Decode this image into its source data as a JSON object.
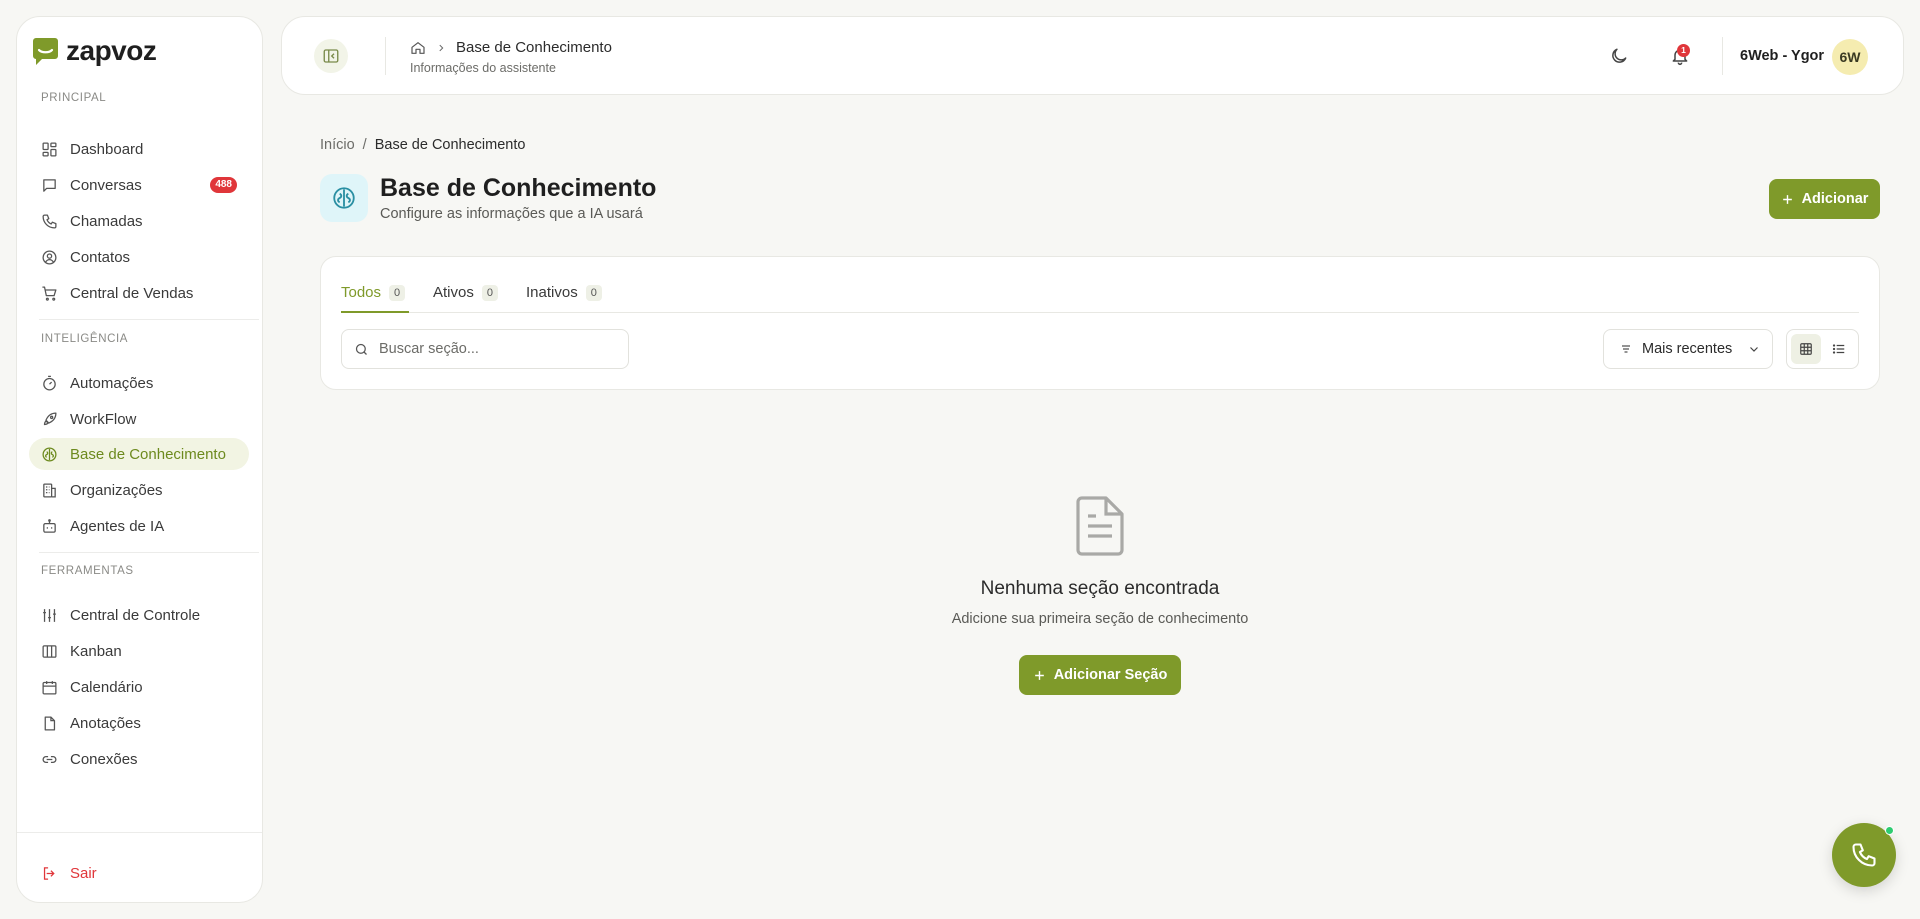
{
  "brand": {
    "name": "zapvoz",
    "accent": "#7f9a2a",
    "danger": "#e0363a"
  },
  "sidebar": {
    "sections": [
      {
        "title": "PRINCIPAL"
      },
      {
        "title": "INTELIGÊNCIA"
      },
      {
        "title": "FERRAMENTAS"
      }
    ],
    "items": [
      {
        "label": "Dashboard",
        "icon": "dashboard-icon"
      },
      {
        "label": "Conversas",
        "icon": "chat-icon",
        "badge": "488"
      },
      {
        "label": "Chamadas",
        "icon": "phone-icon"
      },
      {
        "label": "Contatos",
        "icon": "user-circle-icon"
      },
      {
        "label": "Central de Vendas",
        "icon": "cart-icon"
      },
      {
        "label": "Automações",
        "icon": "timer-icon"
      },
      {
        "label": "WorkFlow",
        "icon": "rocket-icon"
      },
      {
        "label": "Base de Conhecimento",
        "icon": "brain-icon",
        "active": true
      },
      {
        "label": "Organizações",
        "icon": "building-icon"
      },
      {
        "label": "Agentes de IA",
        "icon": "bot-icon"
      },
      {
        "label": "Central de Controle",
        "icon": "sliders-icon"
      },
      {
        "label": "Kanban",
        "icon": "kanban-icon"
      },
      {
        "label": "Calendário",
        "icon": "calendar-icon"
      },
      {
        "label": "Anotações",
        "icon": "file-icon"
      },
      {
        "label": "Conexões",
        "icon": "link-icon"
      }
    ],
    "logout_label": "Sair"
  },
  "header": {
    "title": "Base de Conhecimento",
    "subtitle": "Informações do assistente",
    "notification_count": "1",
    "user_name": "6Web - Ygor",
    "avatar_initials": "6W"
  },
  "page": {
    "breadcrumb": {
      "home": "Início",
      "separator": "/",
      "current": "Base de Conhecimento"
    },
    "title": "Base de Conhecimento",
    "subtitle": "Configure as informações que a IA usará",
    "add_button": "Adicionar"
  },
  "filters": {
    "tabs": [
      {
        "label": "Todos",
        "count": "0",
        "active": true
      },
      {
        "label": "Ativos",
        "count": "0"
      },
      {
        "label": "Inativos",
        "count": "0"
      }
    ],
    "search_placeholder": "Buscar seção...",
    "sort_label": "Mais recentes"
  },
  "empty_state": {
    "title": "Nenhuma seção encontrada",
    "subtitle": "Adicione sua primeira seção de conhecimento",
    "button": "Adicionar Seção"
  }
}
